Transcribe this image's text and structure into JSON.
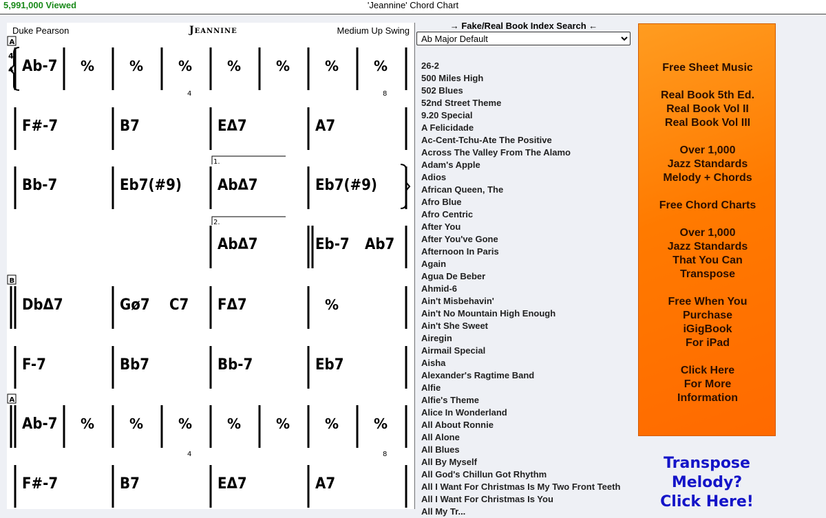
{
  "header": {
    "views": "5,991,000 Viewed",
    "page_title": "'Jeannine' Chord Chart"
  },
  "chart": {
    "composer": "Duke Pearson",
    "song_title": "Jeannine",
    "style": "Medium Up Swing",
    "time_signature": [
      "4",
      "4"
    ],
    "section_markers": [
      "A",
      "B",
      "A"
    ],
    "ending_labels": [
      "1.",
      "2."
    ],
    "measure_numbers": [
      "4",
      "8",
      "4",
      "8"
    ],
    "repeat_symbol": "%",
    "rows": [
      [
        "Ab-7",
        "%",
        "%",
        "%",
        "%",
        "%",
        "%",
        "%"
      ],
      [
        "F#-7",
        "B7",
        "EΔ7",
        "A7"
      ],
      [
        "Bb-7",
        "Eb7(#9)",
        "AbΔ7",
        "Eb7(#9)"
      ],
      [
        "",
        "",
        "AbΔ7",
        "Eb-7 Ab7"
      ],
      [
        "DbΔ7",
        "Gø7 C7",
        "FΔ7",
        "%"
      ],
      [
        "F-7",
        "Bb7",
        "Bb-7",
        "Eb7"
      ],
      [
        "Ab-7",
        "%",
        "%",
        "%",
        "%",
        "%",
        "%",
        "%"
      ],
      [
        "F#-7",
        "B7",
        "EΔ7",
        "A7"
      ]
    ]
  },
  "index": {
    "title": "→ Fake/Real Book Index Search ←",
    "key_selected": "Ab Major Default",
    "songs": [
      "26-2",
      "500 Miles High",
      "502 Blues",
      "52nd Street Theme",
      "9.20 Special",
      "A Felicidade",
      "Ac-Cent-Tchu-Ate The Positive",
      "Across The Valley From The Alamo",
      "Adam's Apple",
      "Adios",
      "African Queen, The",
      "Afro Blue",
      "Afro Centric",
      "After You",
      "After You've Gone",
      "Afternoon In Paris",
      "Again",
      "Agua De Beber",
      "Ahmid-6",
      "Ain't Misbehavin'",
      "Ain't No Mountain High Enough",
      "Ain't She Sweet",
      "Airegin",
      "Airmail Special",
      "Aisha",
      "Alexander's Ragtime Band",
      "Alfie",
      "Alfie's Theme",
      "Alice In Wonderland",
      "All About Ronnie",
      "All Alone",
      "All Blues",
      "All By Myself",
      "All God's Chillun Got Rhythm",
      "All I Want For Christmas Is My Two Front Teeth",
      "All I Want For Christmas Is You",
      "All My Tr..."
    ]
  },
  "promo": {
    "lines": [
      "Free Sheet Music",
      "",
      "Real Book 5th Ed.",
      "Real Book Vol II",
      "Real Book Vol III",
      "",
      "Over 1,000",
      "Jazz Standards",
      "Melody + Chords",
      "",
      "Free Chord Charts",
      "",
      "Over 1,000",
      "Jazz Standards",
      "That You Can",
      "Transpose",
      "",
      "Free When You",
      "Purchase",
      "iGigBook",
      "For iPad",
      "",
      "Click Here",
      "For More",
      "Information"
    ]
  },
  "transpose_link": {
    "lines": [
      "Transpose",
      "Melody?",
      "Click Here!"
    ]
  },
  "colors": {
    "views_green": "#1a8a1a",
    "promo_orange": "#ff7a00",
    "link_blue": "#1414c8"
  }
}
